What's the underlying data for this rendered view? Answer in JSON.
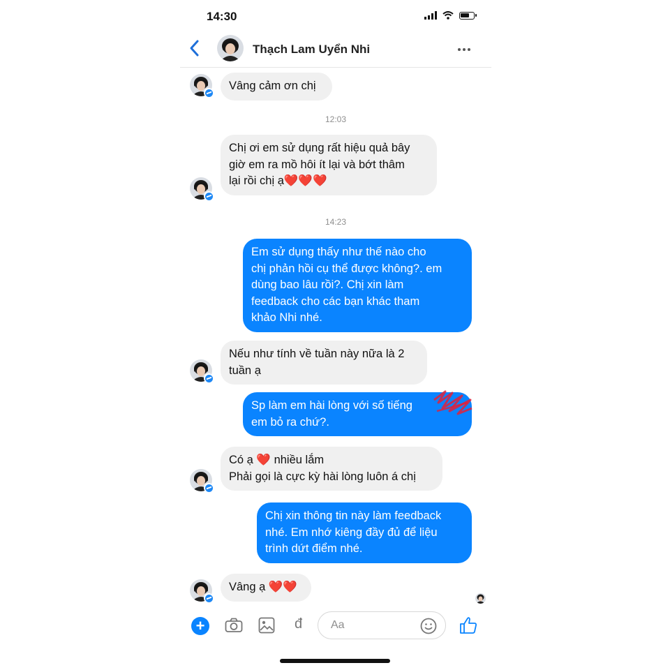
{
  "status": {
    "time": "14:30"
  },
  "header": {
    "contact_name": "Thạch Lam Uyển Nhi"
  },
  "messages": [
    {
      "side": "in",
      "text": "Vâng cảm ơn chị"
    },
    {
      "side": "ts",
      "text": "12:03"
    },
    {
      "side": "in",
      "text": "Chị ơi em sử dụng rất hiệu quả bây\ngiờ em ra mồ hôi ít lại và bớt thâm\nlại rồi chị ạ❤️❤️❤️"
    },
    {
      "side": "ts",
      "text": "14:23"
    },
    {
      "side": "out",
      "text": "Em sử dụng thấy như thế nào cho\nchị phản hồi cụ thể được không?. em\ndùng bao lâu rồi?. Chị xin làm\nfeedback cho các bạn khác tham\nkhảo Nhi nhé."
    },
    {
      "side": "in",
      "text": "Nếu như tính về tuần này nữa là 2\ntuần ạ"
    },
    {
      "side": "out",
      "text": "Sp làm em hài lòng với số tiếng\nem bỏ ra chứ?."
    },
    {
      "side": "in",
      "text": "Có ạ ❤️ nhiều lắm\nPhải gọi là cực kỳ hài lòng luôn á chị"
    },
    {
      "side": "out",
      "text": "Chị xin thông tin này làm feedback\nnhé. Em nhớ kiêng đầy đủ để liệu\ntrình dứt điểm nhé."
    },
    {
      "side": "in",
      "text": "Vâng ạ ❤️❤️"
    }
  ],
  "composer": {
    "placeholder": "Aa",
    "payment_symbol": "đ",
    "plus": "+"
  },
  "icons": [
    "signal-icon",
    "wifi-icon",
    "battery-icon",
    "back-icon",
    "more-icon",
    "messenger-badge-icon",
    "plus-icon",
    "camera-icon",
    "gallery-icon",
    "payment-icon",
    "emoji-icon",
    "like-icon"
  ],
  "colors": {
    "accent": "#0a84ff",
    "incoming_bubble": "#f0f0f0",
    "heart": "#e0213b"
  }
}
